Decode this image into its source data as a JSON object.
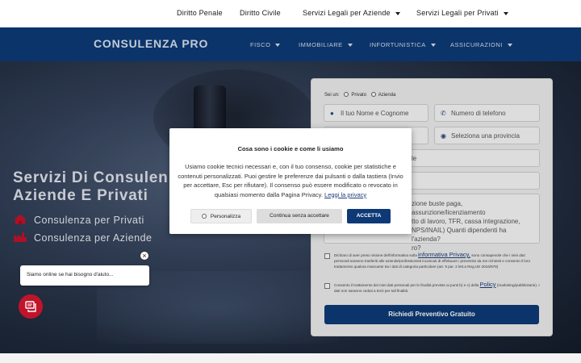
{
  "topbar": {
    "items": [
      "Diritto Penale",
      "Diritto Civile",
      "Servizi Legali per Aziende",
      "Servizi Legali per Privati"
    ]
  },
  "nav": {
    "logo": "CONSULENZA PRO",
    "items": [
      "FISCO",
      "IMMOBILIARE",
      "INFORTUNISTICA",
      "ASSICURAZIONI"
    ]
  },
  "hero": {
    "title_line1": "Servizi Di Consulen",
    "title_line2": "Aziende E Privati",
    "line_private": "Consulenza per Privati",
    "line_business": "Consulenza per Aziende"
  },
  "form": {
    "sei_un": "Sei un:",
    "option_private": "Privato",
    "option_business": "Azienda",
    "name_placeholder": "Il tuo Nome e Cognome",
    "phone_placeholder": "Numero di telefono",
    "province_placeholder": "Seleziona una provincia",
    "select_fragment": "le",
    "textarea_frag1": "zione buste paga, assunzione/licenziamento",
    "textarea_frag2": "tto di lavoro, TFR, cassa integrazione,",
    "textarea_frag3": "NPS/INAIL) Quanti dipendenti ha l'azienda?",
    "textarea_frag4": "ro?",
    "privacy_pre": "Dichiaro di aver preso visione dell'informativa sulla",
    "privacy_link": "informativa Privacy,",
    "privacy_post": "sono consapevole che i miei dati personali saranno trasferiti alle aziende/professionisti incaricati di effettuare i preventivi da me richiesti e consento il loro trattamento qualora mancante tra i dati di categoria particolare (art. 9 par. 2 lett.a Reg.UE 2016/679)",
    "consent_pre": "Consento il trattamento dei miei dati personali per le finalità previste ai punti b) e c) della",
    "consent_link": "Policy",
    "consent_post": "(marketing/pubblicitarie). I dati non saranno ceduti a terzi per tali finalità",
    "submit": "Richiedi Preventivo Gratuito"
  },
  "cookie": {
    "title": "Cosa sono i cookie e come li usiamo",
    "body": "Usiamo cookie tecnici necessari e, con il tuo consenso, cookie per statistiche e contenuti personalizzati. Puoi gestire le preferenze dai pulsanti o dalla tastiera (Invio per accettare, Esc per rifiutare). Il consenso può essere modificato o revocato in qualsiasi momento dalla Pagina Privacy.",
    "link": "Leggi la privacy",
    "btn_customize": "Personalizza",
    "btn_reject": "Continua senza accettare",
    "btn_accept": "ACCETTA"
  },
  "chat": {
    "close": "×",
    "message": "Siamo online se hai bisogno d'aiuto..."
  },
  "colors": {
    "primary": "#0d3a76",
    "chat": "#c0142a"
  }
}
